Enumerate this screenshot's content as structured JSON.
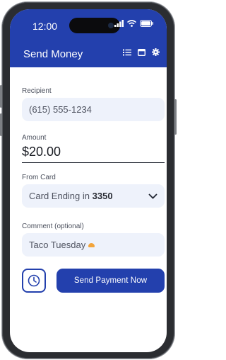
{
  "status_bar": {
    "time": "12:00"
  },
  "header": {
    "title": "Send Money",
    "icons": [
      "list-icon",
      "calendar-icon",
      "gear-icon"
    ]
  },
  "recipient": {
    "label": "Recipient",
    "value": "(615) 555-1234"
  },
  "amount": {
    "label": "Amount",
    "value": "$20.00"
  },
  "from_card": {
    "label": "From Card",
    "prefix": "Card Ending in",
    "last4": "3350"
  },
  "comment": {
    "label": "Comment (optional)",
    "value": "Taco Tuesday"
  },
  "actions": {
    "send_label": "Send Payment Now"
  },
  "colors": {
    "primary": "#2340ad",
    "field_bg": "#eef2fb",
    "frame": "#2b2d31"
  }
}
